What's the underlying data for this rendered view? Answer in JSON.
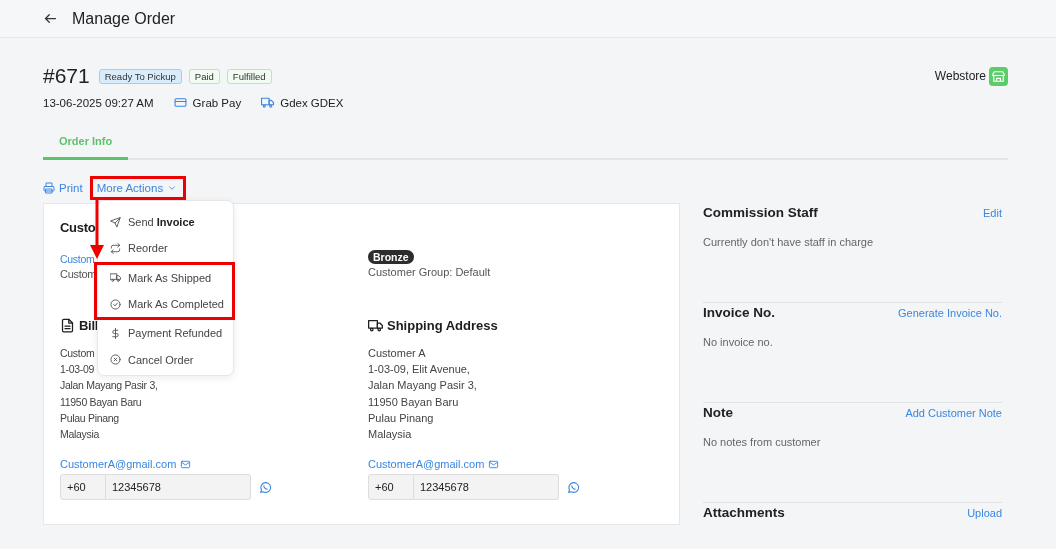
{
  "header": {
    "title": "Manage Order"
  },
  "order": {
    "number": "#671",
    "badges": [
      {
        "label": "Ready To Pickup",
        "kind": "info"
      },
      {
        "label": "Paid",
        "kind": "success"
      },
      {
        "label": "Fulfilled",
        "kind": "success"
      }
    ],
    "date": "13-06-2025 09:27 AM",
    "payment": "Grab Pay",
    "courier": "Gdex GDEX",
    "channel": "Webstore"
  },
  "tabs": [
    {
      "label": "Order Info",
      "selected": true
    }
  ],
  "actions": {
    "print": "Print",
    "more": "More Actions",
    "more_highlighted": true
  },
  "menu": {
    "items": [
      {
        "label": "Send **Invoice**",
        "highlighted": false
      },
      {
        "label": "Reorder",
        "highlighted": false
      },
      {
        "label": "Mark As Shipped",
        "highlighted": true
      },
      {
        "label": "Mark As Completed",
        "highlighted": true
      },
      {
        "label": "Payment Refunded",
        "highlighted": false
      },
      {
        "label": "Cancel Order",
        "highlighted": false
      }
    ]
  },
  "customer": {
    "heading": "Custo",
    "name": "Custom",
    "detail": "Custom",
    "tier": "Bronze",
    "group": "Customer Group: Default"
  },
  "billing": {
    "heading": "Bill",
    "lines": [
      "Custom",
      "1-03-09",
      "Jalan Mayang Pasir 3,",
      "11950 Bayan Baru",
      "Pulau Pinang",
      "Malaysia"
    ],
    "email": "CustomerA@gmail.com",
    "country_code": "+60",
    "phone": "12345678"
  },
  "shipping": {
    "heading": "Shipping Address",
    "lines": [
      "Customer A",
      "1-03-09, Elit Avenue,",
      "Jalan Mayang Pasir 3,",
      "11950 Bayan Baru",
      "Pulau Pinang",
      "Malaysia"
    ],
    "email": "CustomerA@gmail.com",
    "country_code": "+60",
    "phone": "12345678"
  },
  "side": [
    {
      "title": "Commission Staff",
      "action": "Edit",
      "text": "Currently don't have staff in charge"
    },
    {
      "title": "Invoice No.",
      "action": "Generate Invoice No.",
      "text": "No invoice no."
    },
    {
      "title": "Note",
      "action": "Add Customer Note",
      "text": "No notes from customer"
    },
    {
      "title": "Attachments",
      "action": "Upload"
    }
  ]
}
